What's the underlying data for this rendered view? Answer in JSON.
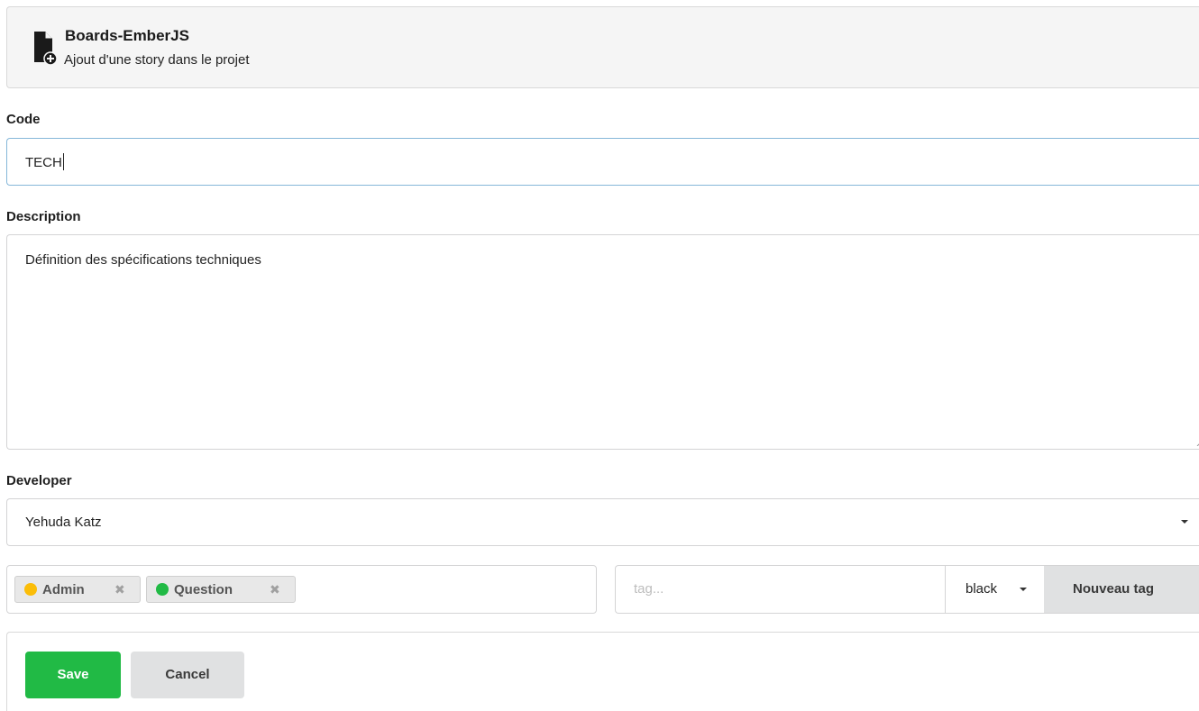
{
  "header": {
    "title": "Boards-EmberJS",
    "subtitle": "Ajout d'une story dans le projet",
    "icon": "file-add-icon"
  },
  "form": {
    "code": {
      "label": "Code",
      "value": "TECH"
    },
    "description": {
      "label": "Description",
      "value": "Définition des spécifications techniques"
    },
    "developer": {
      "label": "Developer",
      "selected": "Yehuda Katz"
    },
    "tags": [
      {
        "label": "Admin",
        "color": "#fbbd08",
        "remove_icon": "✖"
      },
      {
        "label": "Question",
        "color": "#21ba45",
        "remove_icon": "✖"
      }
    ],
    "new_tag": {
      "placeholder": "tag...",
      "color_selected": "black",
      "button_label": "Nouveau tag"
    }
  },
  "actions": {
    "save_label": "Save",
    "cancel_label": "Cancel"
  },
  "colors": {
    "save": "#21ba45",
    "cancel": "#e0e1e2",
    "focus_border": "#85b7d9"
  }
}
